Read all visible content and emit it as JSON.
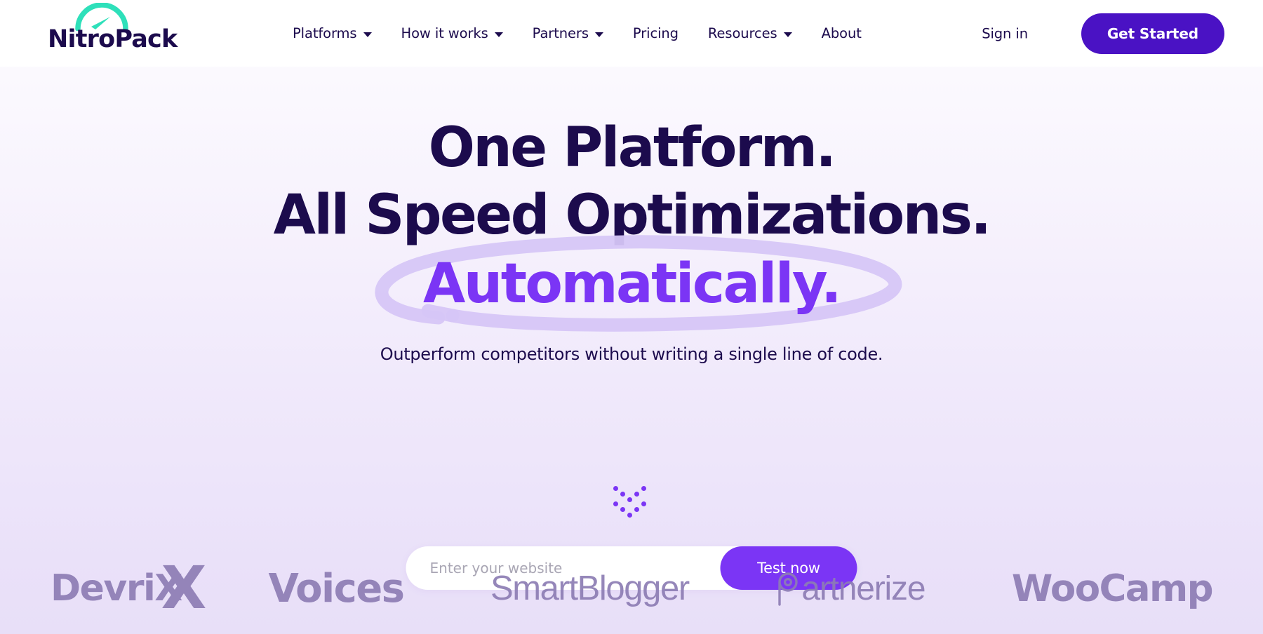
{
  "brand": {
    "name": "NitroPack",
    "logo_icon": "speedometer-gauge-icon",
    "arc_color": "#2EE0BA",
    "text_color": "#1C0B4D"
  },
  "header": {
    "nav": [
      {
        "label": "Platforms",
        "has_dropdown": true
      },
      {
        "label": "How it works",
        "has_dropdown": true
      },
      {
        "label": "Partners",
        "has_dropdown": true
      },
      {
        "label": "Pricing",
        "has_dropdown": false
      },
      {
        "label": "Resources",
        "has_dropdown": true
      },
      {
        "label": "About",
        "has_dropdown": false
      }
    ],
    "sign_in_label": "Sign in",
    "get_started_label": "Get Started",
    "get_started_color": "#4A12C4"
  },
  "hero": {
    "headline_line1": "One Platform.",
    "headline_line2": "All Speed Optimizations.",
    "headline_highlight": "Automatically.",
    "highlight_color": "#7B35F5",
    "headline_color": "#1C0B4D",
    "circle_color": "#D6C6F7",
    "subheadline": "Outperform competitors without writing a single line of code.",
    "scroll_hint_icon": "double-chevron-down-dots-icon"
  },
  "search": {
    "placeholder": "Enter your website",
    "value": "",
    "button_label": "Test now",
    "button_color": "#7B35F5"
  },
  "clients": {
    "logo_color": "#8D7DB4",
    "items": [
      {
        "name": "DevriX",
        "mark": "X"
      },
      {
        "name": "Voices",
        "mark": ""
      },
      {
        "name": "SmartBlogger",
        "mark": ""
      },
      {
        "name": "Partnerize",
        "mark": "P"
      },
      {
        "name": "WooCamp",
        "mark": ""
      }
    ]
  }
}
